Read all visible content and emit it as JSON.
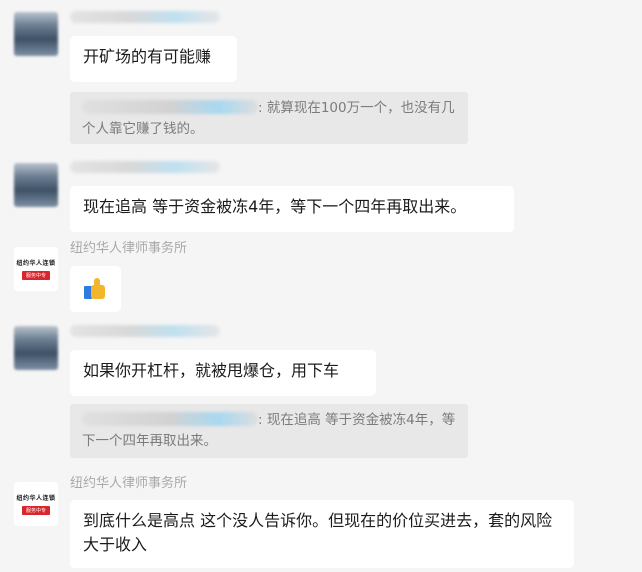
{
  "messages": [
    {
      "text": "开矿场的有可能赚"
    },
    {
      "quote_text": ": 就算现在100万一个，也没有几个人靠它赚了钱的。"
    },
    {
      "text": "现在追高 等于资金被冻4年，等下一个四年再取出来。"
    },
    {
      "sender": "纽约华人律师事务所",
      "emoji": "thumbs-up"
    },
    {
      "text": "如果你开杠杆，就被甩爆仓，用下车"
    },
    {
      "quote_text": ": 现在追高 等于资金被冻4年，等下一个四年再取出来。"
    },
    {
      "sender": "纽约华人律师事务所",
      "text": "到底什么是高点 这个没人告诉你。但现在的价位买进去，套的风险大于收入"
    }
  ],
  "logo": {
    "line1": "纽约华人连锁",
    "badge": "服务中专"
  },
  "colors": {
    "background": "#f5f5f5",
    "bubble": "#ffffff",
    "quote": "#e8e8e8",
    "logo_red": "#d9262c"
  }
}
